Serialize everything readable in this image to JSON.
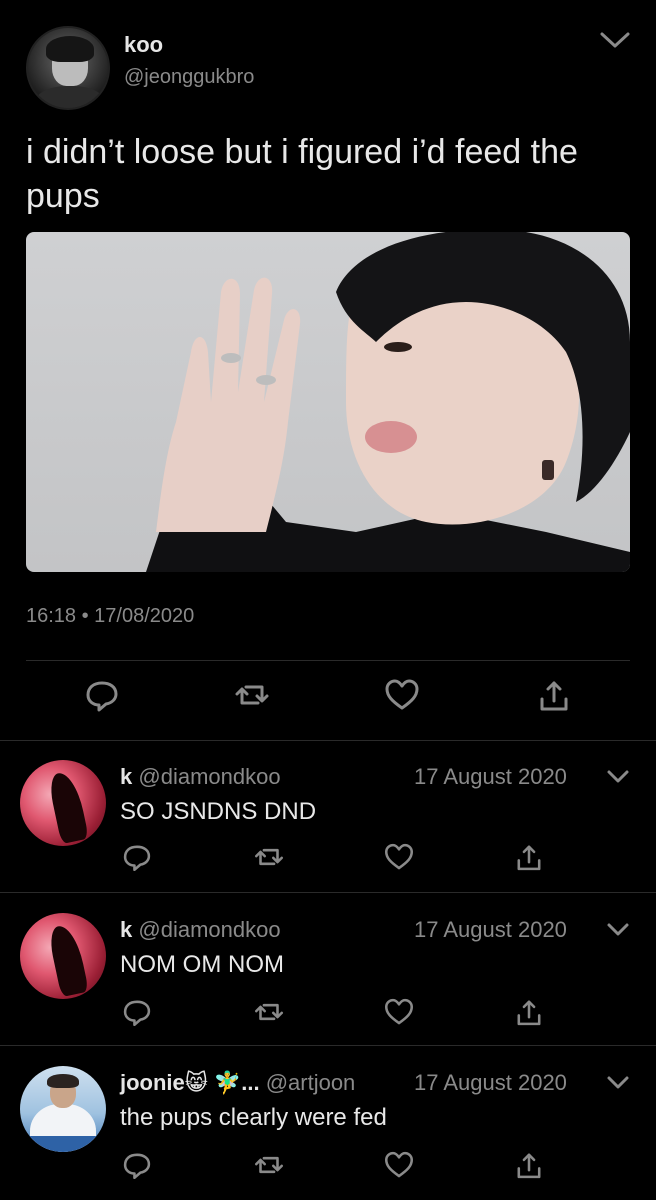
{
  "tweet": {
    "name": "koo",
    "handle": "@jeonggukbro",
    "text": "i didn’t loose but i figured i’d feed the pups",
    "timestamp": "16:18 • 17/08/2020",
    "media_alt": "photo",
    "icons": [
      "reply-icon",
      "retweet-icon",
      "like-icon",
      "share-icon",
      "chevron-down-icon"
    ]
  },
  "replies": [
    {
      "name": "k",
      "handle": "@diamondkoo",
      "date": "17 August 2020",
      "text": "SO JSNDNS DND"
    },
    {
      "name": "k",
      "handle": "@diamondkoo",
      "date": "17 August 2020",
      "text": "NOM OM NOM"
    },
    {
      "name": "joonie😸 🧚‍♂️...",
      "handle": "@artjoon",
      "date": "17 August 2020",
      "text": "the pups clearly were fed"
    }
  ],
  "colors": {
    "background": "#000000",
    "text": "#e8e8e8",
    "muted": "#8a8a8a",
    "divider": "#2a2a2a"
  }
}
